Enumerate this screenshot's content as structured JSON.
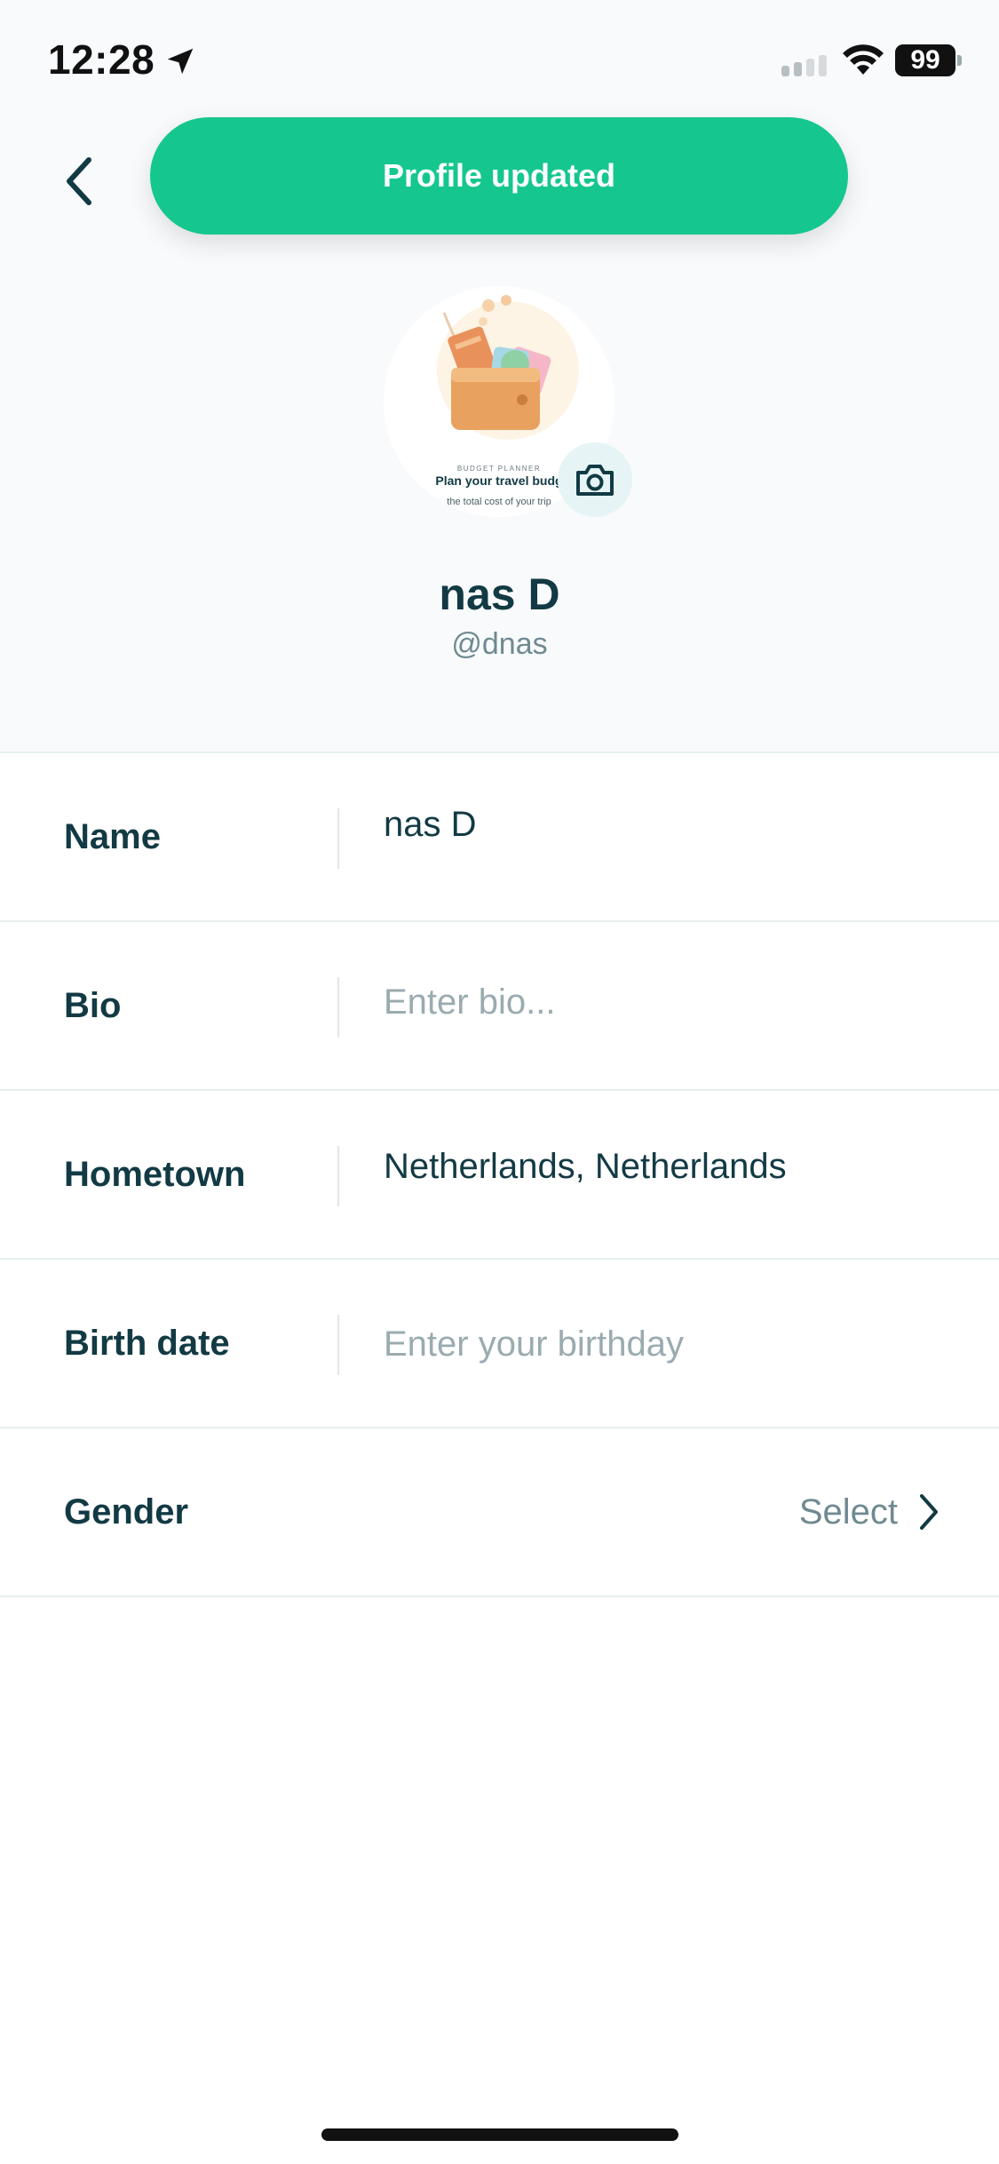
{
  "status_bar": {
    "time": "12:28",
    "battery": "99"
  },
  "toast": {
    "message": "Profile updated"
  },
  "avatar": {
    "image_caption_small": "BUDGET PLANNER",
    "image_caption_title": "Plan your travel budg",
    "image_caption_sub": "the total cost of your trip"
  },
  "profile": {
    "name": "nas D",
    "handle": "@dnas"
  },
  "form": {
    "name": {
      "label": "Name",
      "value": "nas D"
    },
    "bio": {
      "label": "Bio",
      "placeholder": "Enter bio..."
    },
    "hometown": {
      "label": "Hometown",
      "value": "Netherlands, Netherlands"
    },
    "birth_date": {
      "label": "Birth date",
      "placeholder": "Enter your birthday"
    },
    "gender": {
      "label": "Gender",
      "select_label": "Select"
    }
  },
  "colors": {
    "accent": "#15c78f",
    "text_primary": "#123a44",
    "text_secondary": "#6f8a90",
    "placeholder": "#9aabb0"
  }
}
